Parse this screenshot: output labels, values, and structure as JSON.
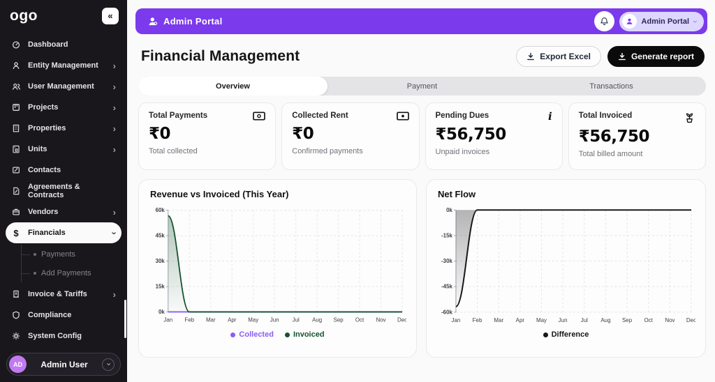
{
  "sidebar": {
    "logo": "ogo",
    "collapse_glyph": "«",
    "items": [
      {
        "label": "Dashboard",
        "icon": "gauge",
        "expand": false
      },
      {
        "label": "Entity Management",
        "icon": "person",
        "expand": true
      },
      {
        "label": "User Management",
        "icon": "users",
        "expand": true
      },
      {
        "label": "Projects",
        "icon": "kanban",
        "expand": true
      },
      {
        "label": "Properties",
        "icon": "building",
        "expand": true
      },
      {
        "label": "Units",
        "icon": "unit",
        "expand": true
      },
      {
        "label": "Contacts",
        "icon": "contact",
        "expand": false
      },
      {
        "label": "Agreements & Contracts",
        "icon": "contract",
        "expand": false
      },
      {
        "label": "Vendors",
        "icon": "briefcase",
        "expand": true
      },
      {
        "label": "Financials",
        "icon": "dollar",
        "active": true,
        "expanded": true,
        "children": [
          "Payments",
          "Add Payments"
        ]
      },
      {
        "label": "Invoice & Tariffs",
        "icon": "invoice",
        "expand": true
      },
      {
        "label": "Compliance",
        "icon": "shield",
        "expand": false
      },
      {
        "label": "System Config",
        "icon": "gear",
        "expand": false
      }
    ],
    "user": {
      "initials": "AD",
      "name": "Admin User"
    }
  },
  "topbar": {
    "brand": "Admin Portal",
    "profile": "Admin Portal"
  },
  "page": {
    "title": "Financial Management",
    "export_label": "Export Excel",
    "report_label": "Generate report"
  },
  "tabs": [
    {
      "label": "Overview",
      "active": true
    },
    {
      "label": "Payment",
      "active": false
    },
    {
      "label": "Transactions",
      "active": false
    }
  ],
  "stats": [
    {
      "title": "Total Payments",
      "value": "₹0",
      "subtitle": "Total collected",
      "icon": "banknote"
    },
    {
      "title": "Collected Rent",
      "value": "₹0",
      "subtitle": "Confirmed payments",
      "icon": "banknote-dot"
    },
    {
      "title": "Pending Dues",
      "value": "₹56,750",
      "subtitle": "Unpaid invoices",
      "icon": "info"
    },
    {
      "title": "Total Invoiced",
      "value": "₹56,750",
      "subtitle": "Total billed amount",
      "icon": "plant"
    }
  ],
  "chart_data": [
    {
      "type": "line",
      "title": "Revenue vs Invoiced (This Year)",
      "x": [
        "Jan",
        "Feb",
        "Mar",
        "Apr",
        "May",
        "Jun",
        "Jul",
        "Aug",
        "Sep",
        "Oct",
        "Nov",
        "Dec"
      ],
      "series": [
        {
          "name": "Collected",
          "color": "#8b5cf6",
          "width": 1.8,
          "area": false,
          "values": [
            0,
            0,
            0,
            0,
            0,
            0,
            0,
            0,
            0,
            0,
            0,
            0
          ]
        },
        {
          "name": "Invoiced",
          "color": "#14532d",
          "width": 1.8,
          "area": true,
          "values": [
            56750,
            0,
            0,
            0,
            0,
            0,
            0,
            0,
            0,
            0,
            0,
            0
          ]
        }
      ],
      "ylim": [
        0,
        60000
      ],
      "yticks": [
        "0k",
        "15k",
        "30k",
        "45k",
        "60k"
      ],
      "grid": true,
      "legend_position": "bottom"
    },
    {
      "type": "line",
      "title": "Net Flow",
      "x": [
        "Jan",
        "Feb",
        "Mar",
        "Apr",
        "May",
        "Jun",
        "Jul",
        "Aug",
        "Sep",
        "Oct",
        "Nov",
        "Dec"
      ],
      "series": [
        {
          "name": "Difference",
          "color": "#18181b",
          "width": 2,
          "area": true,
          "values": [
            -56750,
            0,
            0,
            0,
            0,
            0,
            0,
            0,
            0,
            0,
            0,
            0
          ]
        }
      ],
      "ylim": [
        -60000,
        0
      ],
      "yticks": [
        "-60k",
        "-45k",
        "-30k",
        "-15k",
        "0k"
      ],
      "grid": true,
      "legend_position": "bottom"
    }
  ]
}
